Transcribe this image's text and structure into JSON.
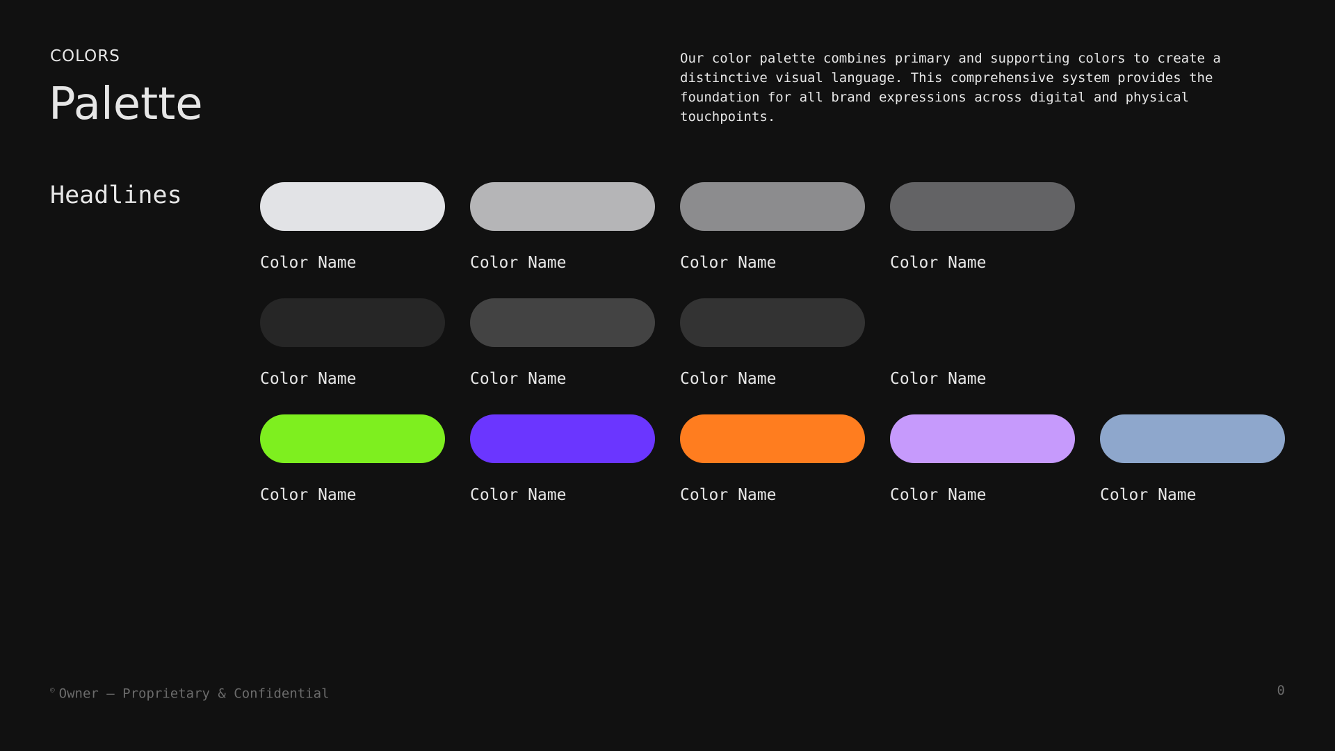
{
  "header": {
    "eyebrow": "COLORS",
    "title": "Palette",
    "intro": "Our color palette combines primary and supporting colors to create a distinctive visual language. This comprehensive system provides the foundation for all brand expressions across digital and physical touchpoints."
  },
  "section": {
    "label": "Headlines"
  },
  "swatches": [
    {
      "color": "#e2e3e6",
      "label": "Color Name"
    },
    {
      "color": "#b5b5b7",
      "label": "Color Name"
    },
    {
      "color": "#8c8c8e",
      "label": "Color Name"
    },
    {
      "color": "#636365",
      "label": "Color Name"
    },
    {
      "color": "",
      "label": ""
    },
    {
      "color": "#262626",
      "label": "Color Name"
    },
    {
      "color": "#434343",
      "label": "Color Name"
    },
    {
      "color": "#333333",
      "label": "Color Name"
    },
    {
      "color": "",
      "label": "Color Name"
    },
    {
      "color": "",
      "label": ""
    },
    {
      "color": "#7eef1f",
      "label": "Color Name"
    },
    {
      "color": "#6b36ff",
      "label": "Color Name"
    },
    {
      "color": "#ff7d1f",
      "label": "Color Name"
    },
    {
      "color": "#c69afc",
      "label": "Color Name"
    },
    {
      "color": "#8ea7cc",
      "label": "Color Name"
    }
  ],
  "footer": {
    "copyright_symbol": "©",
    "owner_text": "Owner — Proprietary & Confidential",
    "page_number": "0"
  }
}
